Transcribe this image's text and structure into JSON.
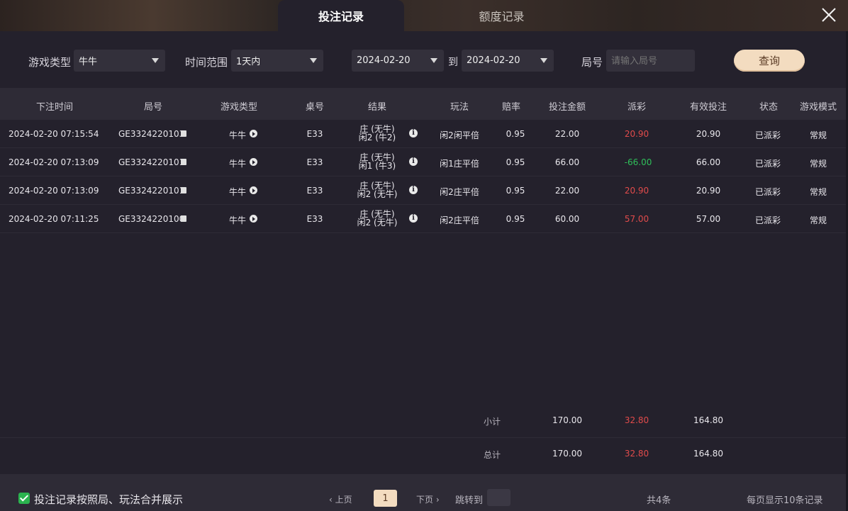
{
  "tabs": {
    "bet_records": "投注记录",
    "credit_records": "额度记录"
  },
  "filters": {
    "game_type_label": "游戏类型",
    "game_type_value": "牛牛",
    "time_range_label": "时间范围",
    "time_range_value": "1天内",
    "date_from": "2024-02-20",
    "date_to_label": "到",
    "date_to": "2024-02-20",
    "round_label": "局号",
    "round_placeholder": "请输入局号",
    "query_button": "查询"
  },
  "table": {
    "headers": [
      "下注时间",
      "局号",
      "游戏类型",
      "桌号",
      "结果",
      "玩法",
      "赔率",
      "投注金额",
      "派彩",
      "有效投注",
      "状态",
      "游戏模式"
    ],
    "rows": [
      {
        "time": "2024-02-20 07:15:54",
        "round": "GE3324220103",
        "game": "牛牛",
        "table": "E33",
        "result_line1": "庄 (无牛)",
        "result_line2": "闲2 (牛2)",
        "play": "闲2闲平倍",
        "odds": "0.95",
        "bet": "22.00",
        "payout": "20.90",
        "payout_color": "red",
        "valid_bet": "20.90",
        "status": "已派彩",
        "mode": "常规"
      },
      {
        "time": "2024-02-20 07:13:09",
        "round": "GE3324220101",
        "game": "牛牛",
        "table": "E33",
        "result_line1": "庄 (无牛)",
        "result_line2": "闲1 (牛3)",
        "play": "闲1庄平倍",
        "odds": "0.95",
        "bet": "66.00",
        "payout": "-66.00",
        "payout_color": "green",
        "valid_bet": "66.00",
        "status": "已派彩",
        "mode": "常规"
      },
      {
        "time": "2024-02-20 07:13:09",
        "round": "GE3324220101",
        "game": "牛牛",
        "table": "E33",
        "result_line1": "庄 (无牛)",
        "result_line2": "闲2 (无牛)",
        "play": "闲2庄平倍",
        "odds": "0.95",
        "bet": "22.00",
        "payout": "20.90",
        "payout_color": "red",
        "valid_bet": "20.90",
        "status": "已派彩",
        "mode": "常规"
      },
      {
        "time": "2024-02-20 07:11:25",
        "round": "GE3324220100",
        "game": "牛牛",
        "table": "E33",
        "result_line1": "庄 (无牛)",
        "result_line2": "闲2 (无牛)",
        "play": "闲2庄平倍",
        "odds": "0.95",
        "bet": "60.00",
        "payout": "57.00",
        "payout_color": "red",
        "valid_bet": "57.00",
        "status": "已派彩",
        "mode": "常规"
      }
    ]
  },
  "summary": {
    "subtotal_label": "小计",
    "subtotal_bet": "170.00",
    "subtotal_payout": "32.80",
    "subtotal_valid": "164.80",
    "total_label": "总计",
    "total_bet": "170.00",
    "total_payout": "32.80",
    "total_valid": "164.80"
  },
  "footer": {
    "merge_label": "投注记录按照局、玩法合并展示",
    "prev": "‹ 上页",
    "current_page": "1",
    "next": "下页 ›",
    "jump_label": "跳转到",
    "total_count": "共4条",
    "per_page": "每页显示10条记录"
  },
  "colors": {
    "background": "#24212c",
    "accent": "#f3dcc0",
    "positive": "#e14b4b",
    "negative": "#2fbf5a",
    "checkbox": "#2bb34f"
  },
  "icons": [
    "close-icon",
    "caret-down-icon",
    "copy-icon",
    "play-icon",
    "info-icon",
    "checkbox-checked-icon"
  ]
}
